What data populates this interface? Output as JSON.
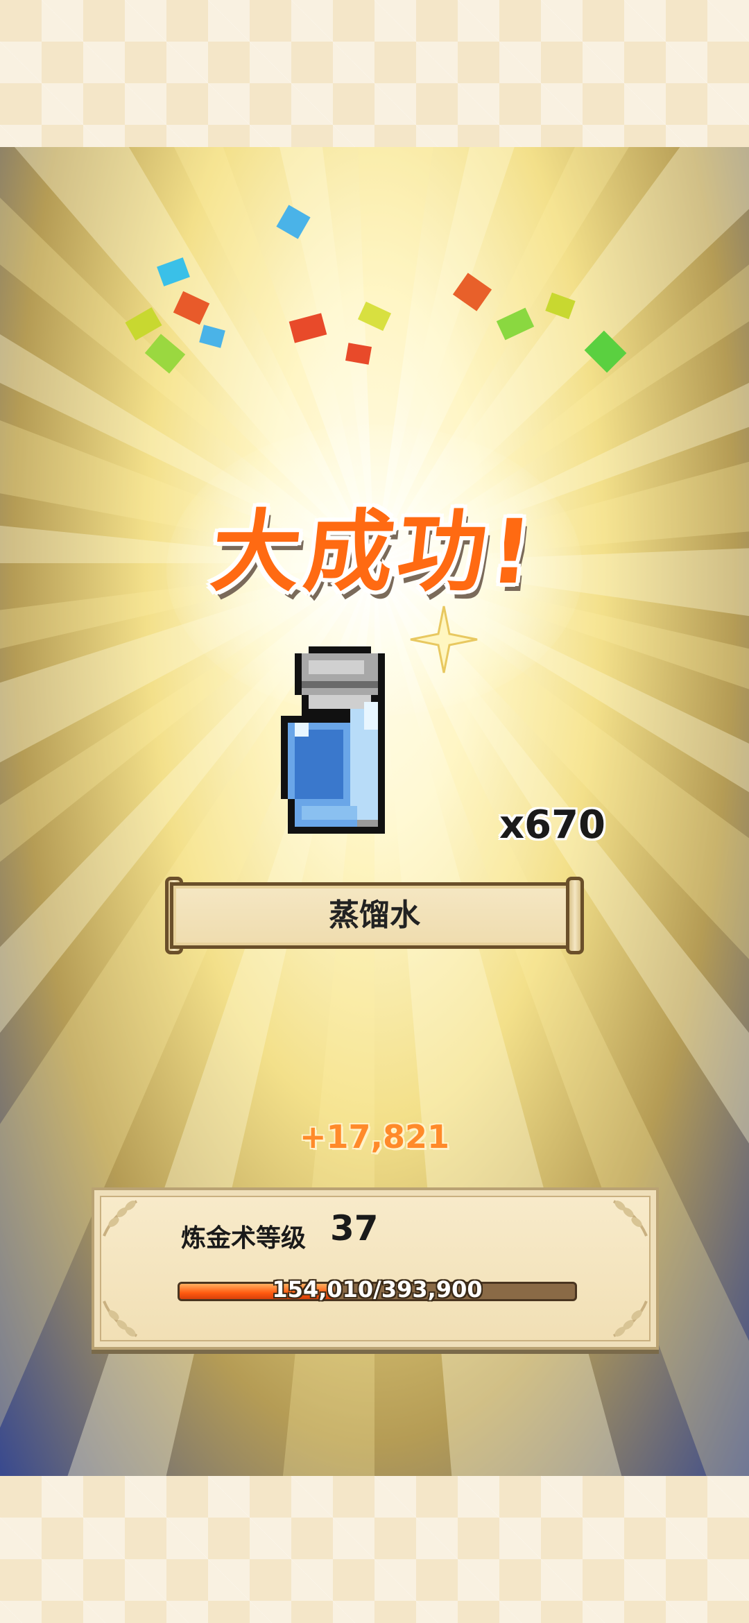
{
  "result": {
    "title": "大成功!",
    "item_icon": "distilled-water-bottle-icon",
    "quantity": "x670",
    "item_name": "蒸馏水"
  },
  "experience": {
    "gain": "+17,821",
    "level_label": "炼金术等级",
    "level_value": "37",
    "progress_text": "154,010/393,900",
    "progress_current": 154010,
    "progress_max": 393900
  },
  "colors": {
    "title": "#ff6a12",
    "exp_gain": "#ff8a2a",
    "progress_fill": "#ff5a10",
    "background_deep": "#1a2a78",
    "parchment": "#f4e6c8"
  }
}
